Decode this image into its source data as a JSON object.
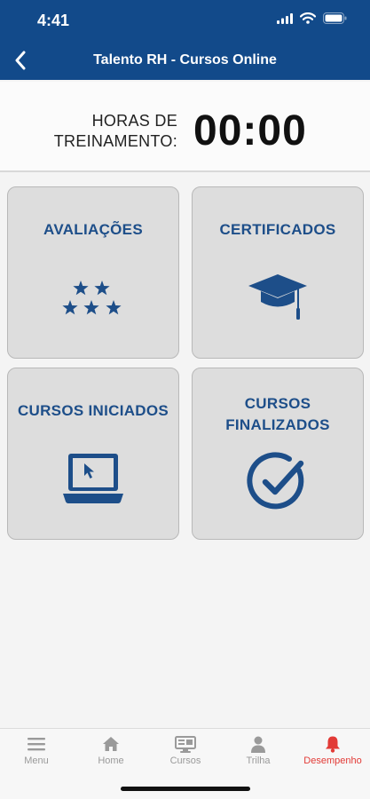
{
  "status_bar": {
    "time": "4:41"
  },
  "nav": {
    "title": "Talento RH - Cursos Online",
    "back_icon": "chevron-left-icon"
  },
  "hours": {
    "label": "HORAS DE TREINAMENTO:",
    "value": "00:00"
  },
  "cards": [
    {
      "title": "AVALIAÇÕES",
      "icon": "stars-icon"
    },
    {
      "title": "CERTIFICADOS",
      "icon": "graduation-cap-icon"
    },
    {
      "title": "CURSOS INICIADOS",
      "icon": "laptop-icon"
    },
    {
      "title": "CURSOS FINALIZADOS",
      "icon": "check-circle-icon"
    }
  ],
  "tabs": [
    {
      "label": "Menu",
      "icon": "menu-icon"
    },
    {
      "label": "Home",
      "icon": "home-icon"
    },
    {
      "label": "Cursos",
      "icon": "monitor-icon"
    },
    {
      "label": "Trilha",
      "icon": "person-icon"
    },
    {
      "label": "Desempenho",
      "icon": "bell-icon",
      "active": true
    }
  ],
  "colors": {
    "brand": "#124a8a",
    "card_title": "#1d4e89",
    "active_tab": "#e23a36",
    "inactive_tab": "#9a9a9a"
  }
}
